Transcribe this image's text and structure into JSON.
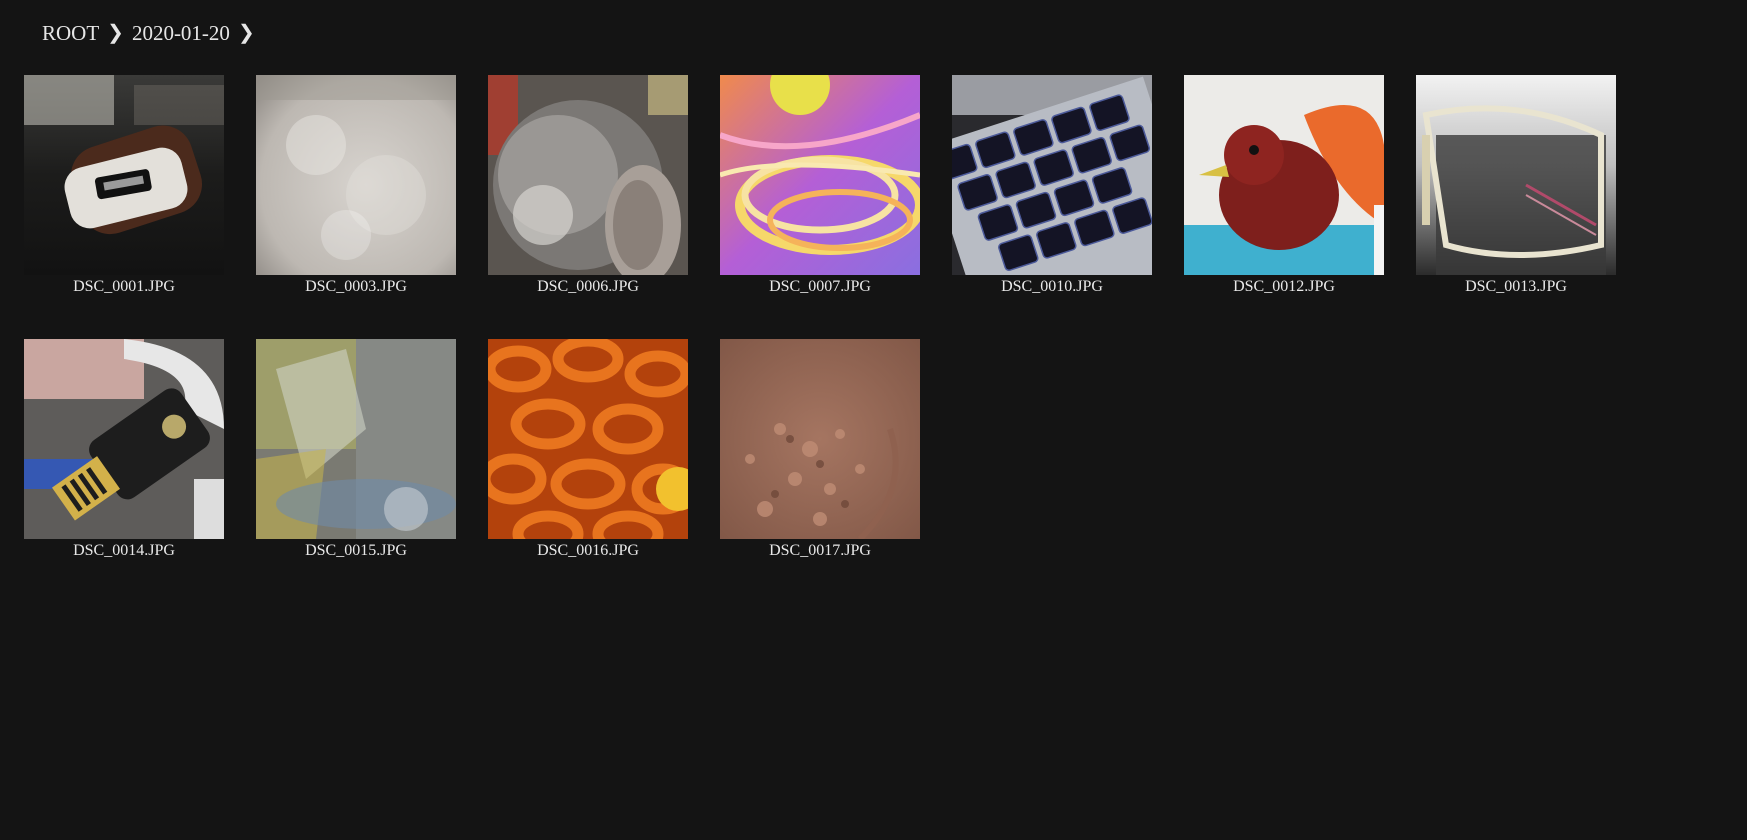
{
  "breadcrumb": {
    "items": [
      "ROOT",
      "2020-01-20"
    ],
    "separator": "❯"
  },
  "gallery": {
    "items": [
      {
        "filename": "DSC_0001.JPG",
        "subject": "hdmi-adapter"
      },
      {
        "filename": "DSC_0003.JPG",
        "subject": "white-fluff"
      },
      {
        "filename": "DSC_0006.JPG",
        "subject": "grey-plush"
      },
      {
        "filename": "DSC_0007.JPG",
        "subject": "colored-strands"
      },
      {
        "filename": "DSC_0010.JPG",
        "subject": "keyboard"
      },
      {
        "filename": "DSC_0012.JPG",
        "subject": "red-glitter-bird"
      },
      {
        "filename": "DSC_0013.JPG",
        "subject": "eyeglasses"
      },
      {
        "filename": "DSC_0014.JPG",
        "subject": "usb-security-key"
      },
      {
        "filename": "DSC_0015.JPG",
        "subject": "plastic-wrap"
      },
      {
        "filename": "DSC_0016.JPG",
        "subject": "pretzels"
      },
      {
        "filename": "DSC_0017.JPG",
        "subject": "cocoa-powder"
      }
    ]
  },
  "colors": {
    "background": "#141414",
    "text": "#e6e6e6"
  }
}
